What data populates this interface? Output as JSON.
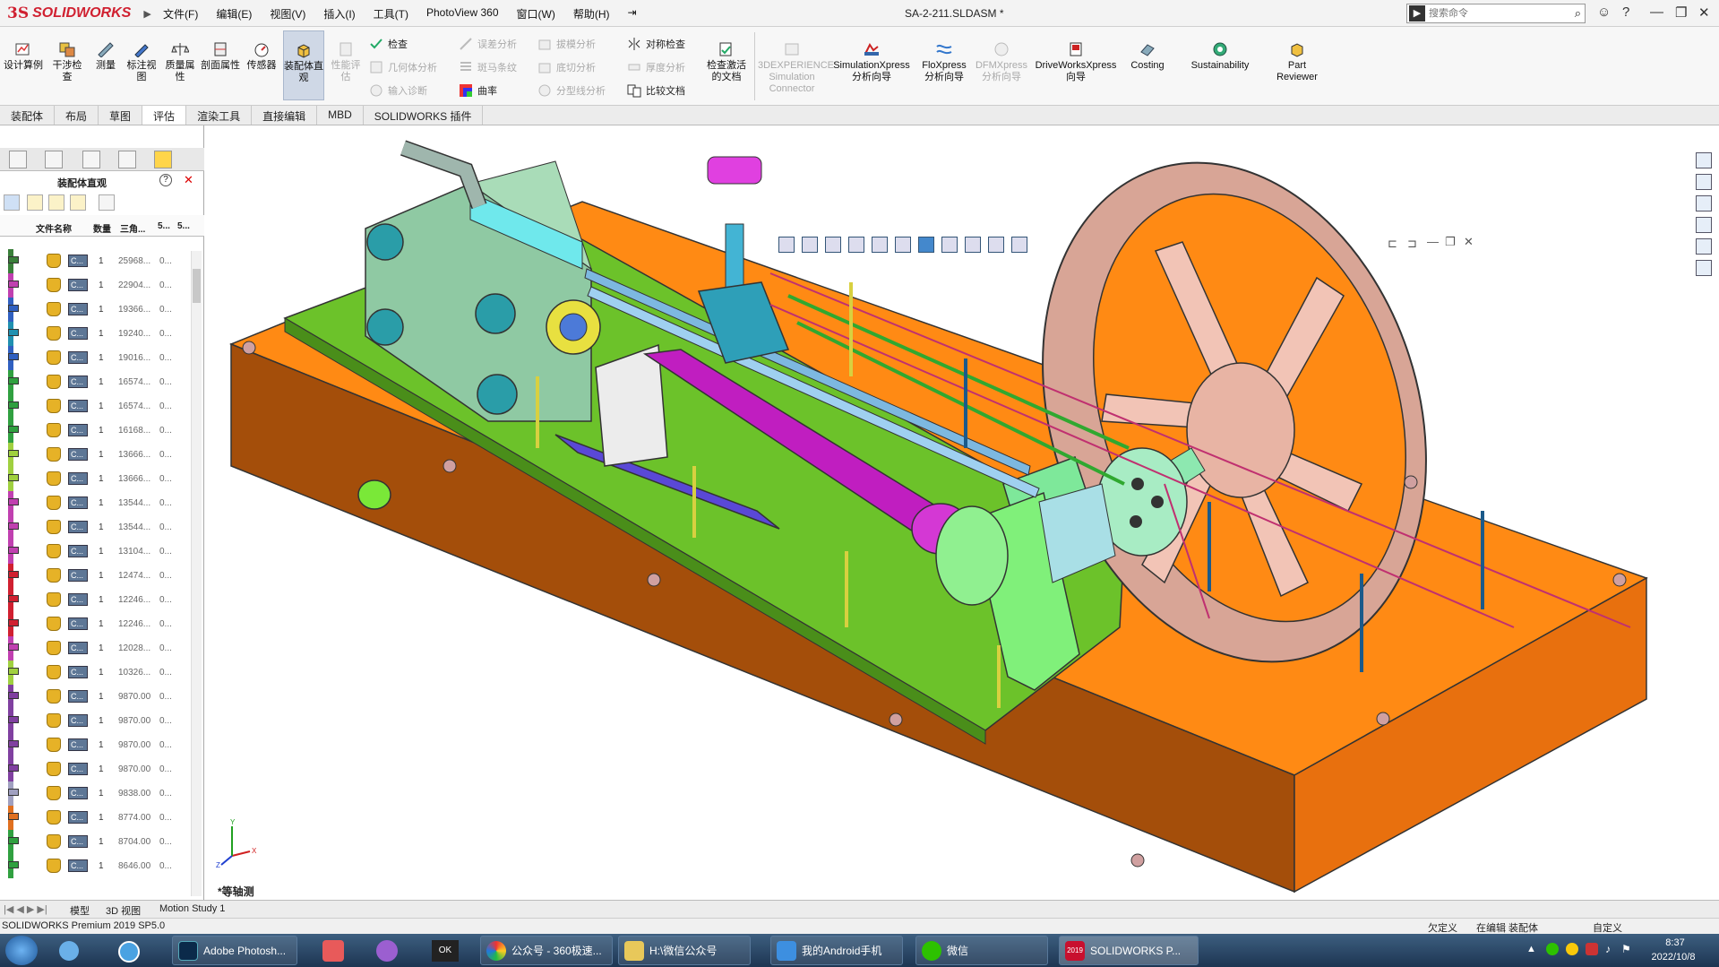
{
  "titlebar": {
    "logo_ds": "3S",
    "logo_text": "SOLIDWORKS",
    "menus": [
      "文件(F)",
      "编辑(E)",
      "视图(V)",
      "插入(I)",
      "工具(T)",
      "PhotoView 360",
      "窗口(W)",
      "帮助(H)"
    ],
    "document_title": "SA-2-211.SLDASM *",
    "search_placeholder": "搜索命令"
  },
  "ribbon": {
    "big_buttons": [
      {
        "label": "设计算例",
        "enabled": true
      },
      {
        "label": "干涉检查",
        "enabled": true
      },
      {
        "label": "测量",
        "enabled": true
      },
      {
        "label": "标注视图",
        "enabled": true
      },
      {
        "label": "质量属性",
        "enabled": true
      },
      {
        "label": "剖面属性",
        "enabled": true
      },
      {
        "label": "传感器",
        "enabled": true
      },
      {
        "label": "装配体直观",
        "enabled": true,
        "active": true
      },
      {
        "label": "性能评估",
        "enabled": false
      }
    ],
    "small_col1": [
      {
        "label": "检查",
        "enabled": true
      },
      {
        "label": "几何体分析",
        "enabled": false
      },
      {
        "label": "输入诊断",
        "enabled": false
      }
    ],
    "small_col2": [
      {
        "label": "误差分析",
        "enabled": false
      },
      {
        "label": "斑马条纹",
        "enabled": false
      },
      {
        "label": "曲率",
        "enabled": true
      }
    ],
    "small_col3": [
      {
        "label": "拔模分析",
        "enabled": false
      },
      {
        "label": "底切分析",
        "enabled": false
      },
      {
        "label": "分型线分析",
        "enabled": false
      }
    ],
    "small_col4": [
      {
        "label": "对称检查",
        "enabled": true
      },
      {
        "label": "厚度分析",
        "enabled": false
      },
      {
        "label": "比较文档",
        "enabled": true
      }
    ],
    "check_active_doc": "检查激活的文档",
    "addins": [
      {
        "label": "3DEXPERIENCE Simulation Connector",
        "enabled": false
      },
      {
        "label": "SimulationXpress 分析向导",
        "enabled": true
      },
      {
        "label": "FloXpress 分析向导",
        "enabled": true
      },
      {
        "label": "DFMXpress 分析向导",
        "enabled": false
      },
      {
        "label": "DriveWorksXpress 向导",
        "enabled": true
      },
      {
        "label": "Costing",
        "enabled": true
      },
      {
        "label": "Sustainability",
        "enabled": true
      },
      {
        "label": "Part Reviewer",
        "enabled": true
      }
    ]
  },
  "tabs": [
    "装配体",
    "布局",
    "草图",
    "评估",
    "渲染工具",
    "直接编辑",
    "MBD",
    "SOLIDWORKS 插件"
  ],
  "active_tab": "评估",
  "left_panel": {
    "title": "装配体直观",
    "columns": [
      "文件名称",
      "数量",
      "三角...",
      "5...",
      "5..."
    ],
    "rows": [
      {
        "color": "#3a7f3a",
        "name": "C...",
        "qty": "1",
        "value": "25968...",
        "z": "0..."
      },
      {
        "color": "#c040b0",
        "name": "C...",
        "qty": "1",
        "value": "22904...",
        "z": "0..."
      },
      {
        "color": "#3060c0",
        "name": "C...",
        "qty": "1",
        "value": "19366...",
        "z": "0..."
      },
      {
        "color": "#2090b0",
        "name": "C...",
        "qty": "1",
        "value": "19240...",
        "z": "0..."
      },
      {
        "color": "#3060c0",
        "name": "C...",
        "qty": "1",
        "value": "19016...",
        "z": "0..."
      },
      {
        "color": "#30a040",
        "name": "C...",
        "qty": "1",
        "value": "16574...",
        "z": "0..."
      },
      {
        "color": "#30a040",
        "name": "C...",
        "qty": "1",
        "value": "16574...",
        "z": "0..."
      },
      {
        "color": "#30a040",
        "name": "C...",
        "qty": "1",
        "value": "16168...",
        "z": "0..."
      },
      {
        "color": "#a0d040",
        "name": "C...",
        "qty": "1",
        "value": "13666...",
        "z": "0..."
      },
      {
        "color": "#a0d040",
        "name": "C...",
        "qty": "1",
        "value": "13666...",
        "z": "0..."
      },
      {
        "color": "#c040b0",
        "name": "C...",
        "qty": "1",
        "value": "13544...",
        "z": "0..."
      },
      {
        "color": "#c040b0",
        "name": "C...",
        "qty": "1",
        "value": "13544...",
        "z": "0..."
      },
      {
        "color": "#c040b0",
        "name": "C...",
        "qty": "1",
        "value": "13104...",
        "z": "0..."
      },
      {
        "color": "#d02030",
        "name": "C...",
        "qty": "1",
        "value": "12474...",
        "z": "0..."
      },
      {
        "color": "#d02030",
        "name": "C...",
        "qty": "1",
        "value": "12246...",
        "z": "0..."
      },
      {
        "color": "#d02030",
        "name": "C...",
        "qty": "1",
        "value": "12246...",
        "z": "0..."
      },
      {
        "color": "#c040b0",
        "name": "C...",
        "qty": "1",
        "value": "12028...",
        "z": "0..."
      },
      {
        "color": "#a0d040",
        "name": "C...",
        "qty": "1",
        "value": "10326...",
        "z": "0..."
      },
      {
        "color": "#8040a0",
        "name": "C...",
        "qty": "1",
        "value": "9870.00",
        "z": "0..."
      },
      {
        "color": "#8040a0",
        "name": "C...",
        "qty": "1",
        "value": "9870.00",
        "z": "0..."
      },
      {
        "color": "#8040a0",
        "name": "C...",
        "qty": "1",
        "value": "9870.00",
        "z": "0..."
      },
      {
        "color": "#8040a0",
        "name": "C...",
        "qty": "1",
        "value": "9870.00",
        "z": "0..."
      },
      {
        "color": "#a0a0c0",
        "name": "C...",
        "qty": "1",
        "value": "9838.00",
        "z": "0..."
      },
      {
        "color": "#e07020",
        "name": "C...",
        "qty": "1",
        "value": "8774.00",
        "z": "0..."
      },
      {
        "color": "#30a040",
        "name": "C...",
        "qty": "1",
        "value": "8704.00",
        "z": "0..."
      },
      {
        "color": "#30a040",
        "name": "C...",
        "qty": "1",
        "value": "8646.00",
        "z": "0..."
      }
    ]
  },
  "viewport": {
    "view_label": "*等轴测",
    "triad": {
      "x": "X",
      "y": "Y",
      "z": "Z"
    }
  },
  "bottom_tabs": [
    "模型",
    "3D 视图",
    "Motion Study 1"
  ],
  "status": {
    "product": "SOLIDWORKS Premium 2019 SP5.0",
    "state1": "欠定义",
    "state2": "在编辑 装配体",
    "state3": "自定义"
  },
  "taskbar": {
    "items": [
      "Adobe Photosh...",
      "公众号 - 360极速...",
      "H:\\微信公众号",
      "我的Android手机",
      "微信",
      "SOLIDWORKS P..."
    ],
    "sw_badge": "2019",
    "time": "8:37",
    "date": "2022/10/8"
  }
}
